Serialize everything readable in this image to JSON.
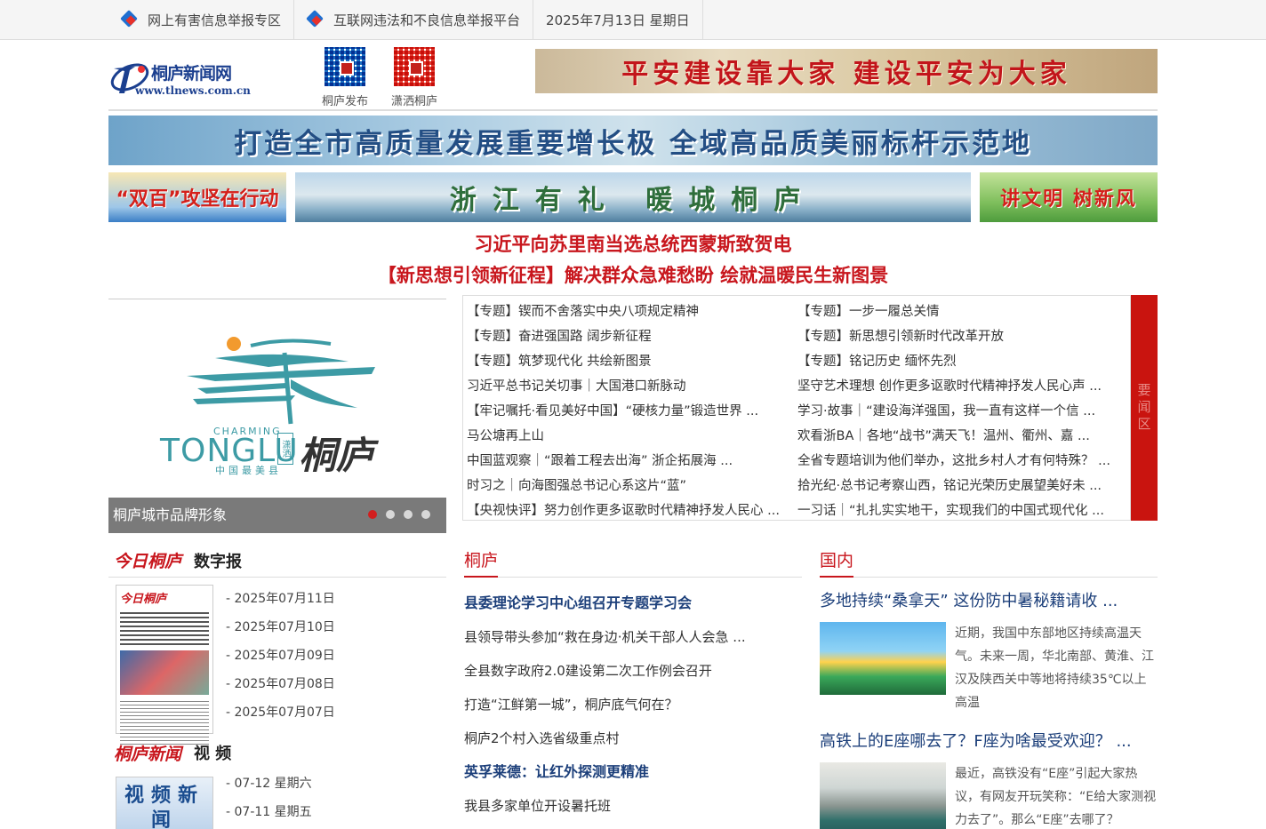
{
  "topbar": {
    "items": [
      {
        "label": "网上有害信息举报专区",
        "icon": "report-icon"
      },
      {
        "label": "互联网违法和不良信息举报平台",
        "icon": "report-icon"
      },
      {
        "label": "2025年7月13日  星期日"
      }
    ]
  },
  "header": {
    "logo_cn": "桐庐新闻网",
    "logo_en": "www.tlnews.com.cn",
    "qr1_label": "桐庐发布",
    "qr2_label": "潇洒桐庐",
    "banner_top": "平安建设靠大家  建设平安为大家"
  },
  "banners": {
    "wide": "打造全市高质量发展重要增长极  全域高品质美丽标杆示范地",
    "left": "“双百”攻坚在行动",
    "mid": "浙江有礼  暖城桐庐",
    "right": "讲文明 树新风"
  },
  "headlines": [
    "习近平向苏里南当选总统西蒙斯致贺电",
    "【新思想引领新征程】解决群众急难愁盼 绘就温暖民生新图景"
  ],
  "slider": {
    "brand_en": "CHARMING",
    "brand_main": "TONGLU",
    "brand_seal": "潇洒",
    "brand_cn": "桐庐",
    "brand_sub": "中国最美县",
    "caption": "桐庐城市品牌形象"
  },
  "news_box": {
    "side_label": "要闻区",
    "items": [
      "【专题】锲而不舍落实中央八项规定精神",
      "【专题】一步一履总关情",
      "【专题】奋进强国路 阔步新征程",
      "【专题】新思想引领新时代改革开放",
      "【专题】筑梦现代化 共绘新图景",
      "【专题】铭记历史 缅怀先烈",
      "习近平总书记关切事｜大国港口新脉动",
      "坚守艺术理想 创作更多讴歌时代精神抒发人民心声 ...",
      "【牢记嘱托·看见美好中国】“硬核力量”锻造世界 ...",
      "学习·故事｜“建设海洋强国，我一直有这样一个信 ...",
      "马公塘再上山",
      "欢看浙BA｜各地“战书”满天飞！温州、衢州、嘉 ...",
      "中国蓝观察｜“跟着工程去出海” 浙企拓展海 ...",
      "全省专题培训为他们举办，这批乡村人才有何特殊？ ...",
      "时习之｜向海图强总书记心系这片“蓝”",
      "拾光纪·总书记考察山西，铭记光荣历史展望美好未 ...",
      "【央视快评】努力创作更多讴歌时代精神抒发人民心 ...",
      "一习话｜“扎扎实实地干，实现我们的中国式现代化 ..."
    ]
  },
  "epaper": {
    "brand": "今日桐庐",
    "title": "数字报",
    "thumb_mast": "今日桐庐",
    "dates": [
      "- 2025年07月11日",
      "- 2025年07月10日",
      "- 2025年07月09日",
      "- 2025年07月08日",
      "- 2025年07月07日"
    ]
  },
  "video": {
    "brand": "桐庐新闻",
    "title": "视 频",
    "thumb_text": "视频新闻",
    "dates": [
      "- 07-12 星期六",
      "- 07-11 星期五"
    ]
  },
  "tonglu": {
    "title": "桐庐",
    "items": [
      {
        "text": "县委理论学习中心组召开专题学习会",
        "strong": true
      },
      {
        "text": "县领导带头参加“救在身边·机关干部人人会急 ...",
        "strong": false
      },
      {
        "text": "全县数字政府2.0建设第二次工作例会召开",
        "strong": false
      },
      {
        "text": "打造“江鲜第一城”，桐庐底气何在？",
        "strong": false
      },
      {
        "text": "桐庐2个村入选省级重点村",
        "strong": false
      },
      {
        "text": "英孚莱德：让红外探测更精准",
        "strong": true
      },
      {
        "text": "我县多家单位开设暑托班",
        "strong": false
      }
    ]
  },
  "domestic": {
    "title": "国内",
    "stories": [
      {
        "title": "多地持续“桑拿天” 这份防中暑秘籍请收 ...",
        "summary": "近期，我国中东部地区持续高温天气。未来一周，华北南部、黄淮、江汉及陕西关中等地将持续35℃以上高温"
      },
      {
        "title": "高铁上的E座哪去了？F座为啥最受欢迎？ ...",
        "summary": "最近，高铁没有“E座”引起大家热议，有网友开玩笑称：“E给大家测视力去了”。那么“E座”去哪了？"
      }
    ]
  }
}
